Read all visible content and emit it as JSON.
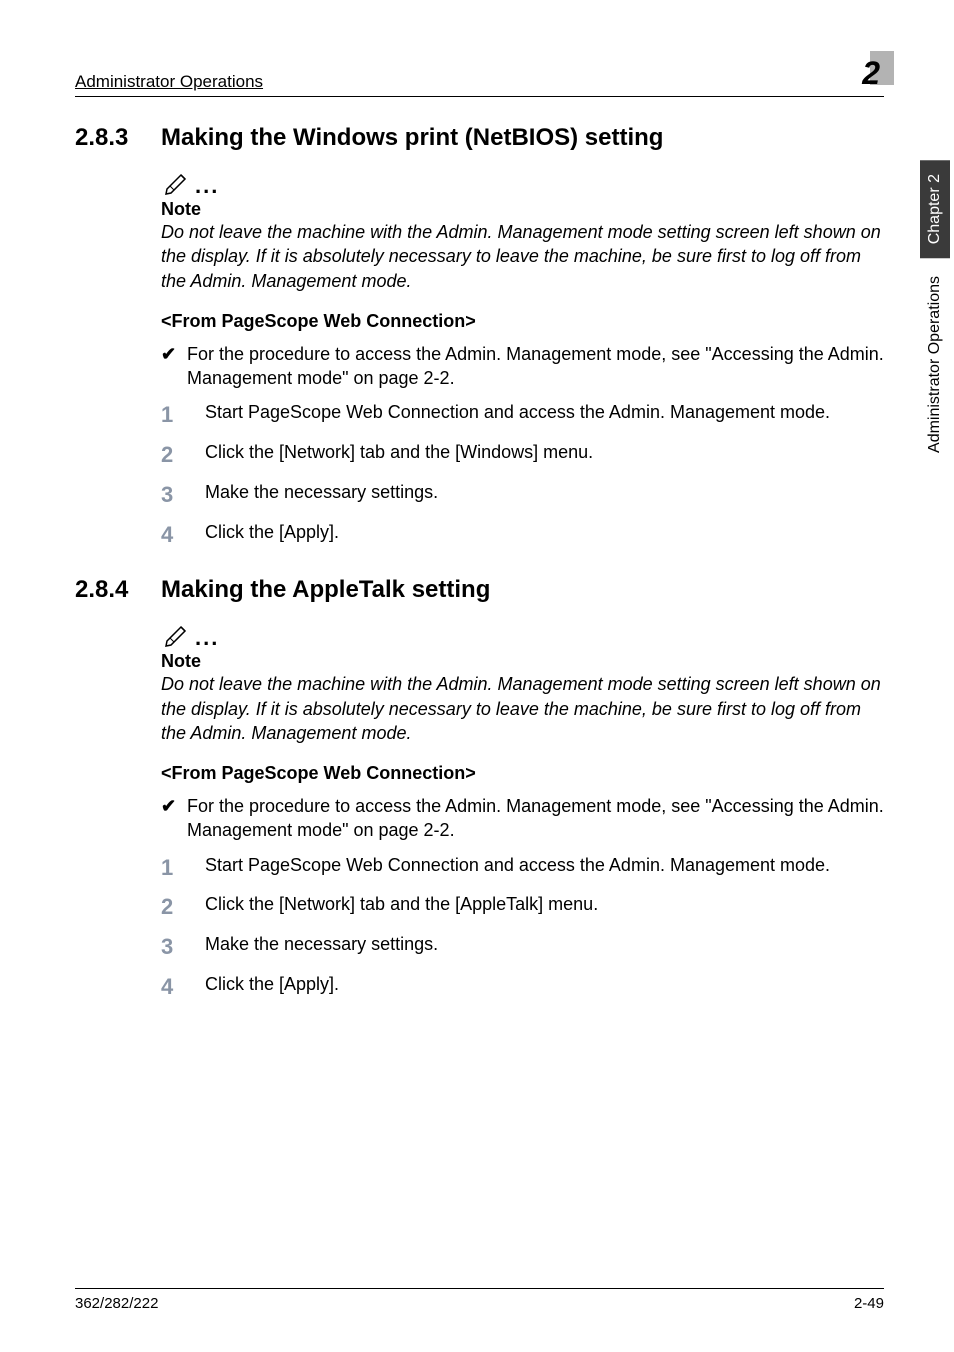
{
  "header": {
    "left": "Administrator Operations",
    "right": "2"
  },
  "section1": {
    "num": "2.8.3",
    "title": "Making the Windows print (NetBIOS) setting",
    "note_label": "Note",
    "note_text": "Do not leave the machine with the Admin. Management mode setting screen left shown on the display. If it is absolutely necessary to leave the machine, be sure first to log off from the Admin. Management mode.",
    "sub": "<From PageScope Web Connection>",
    "check": "For the procedure to access the Admin. Management mode, see \"Accessing the Admin. Management mode\" on page 2-2.",
    "steps": [
      "Start PageScope Web Connection and access the Admin. Management mode.",
      "Click the [Network] tab and the [Windows] menu.",
      "Make the necessary settings.",
      "Click the [Apply]."
    ]
  },
  "section2": {
    "num": "2.8.4",
    "title": "Making the AppleTalk setting",
    "note_label": "Note",
    "note_text": "Do not leave the machine with the Admin. Management mode setting screen left shown on the display. If it is absolutely necessary to leave the machine, be sure first to log off from the Admin. Management mode.",
    "sub": "<From PageScope Web Connection>",
    "check": "For the procedure to access the Admin. Management mode, see \"Accessing the Admin. Management mode\" on page 2-2.",
    "steps": [
      "Start PageScope Web Connection and access the Admin. Management mode.",
      "Click the [Network] tab and the [AppleTalk] menu.",
      "Make the necessary settings.",
      "Click the [Apply]."
    ]
  },
  "sidetab": {
    "dark": "Chapter 2",
    "light": "Administrator Operations"
  },
  "footer": {
    "left": "362/282/222",
    "right": "2-49"
  },
  "step_nums": [
    "1",
    "2",
    "3",
    "4"
  ]
}
